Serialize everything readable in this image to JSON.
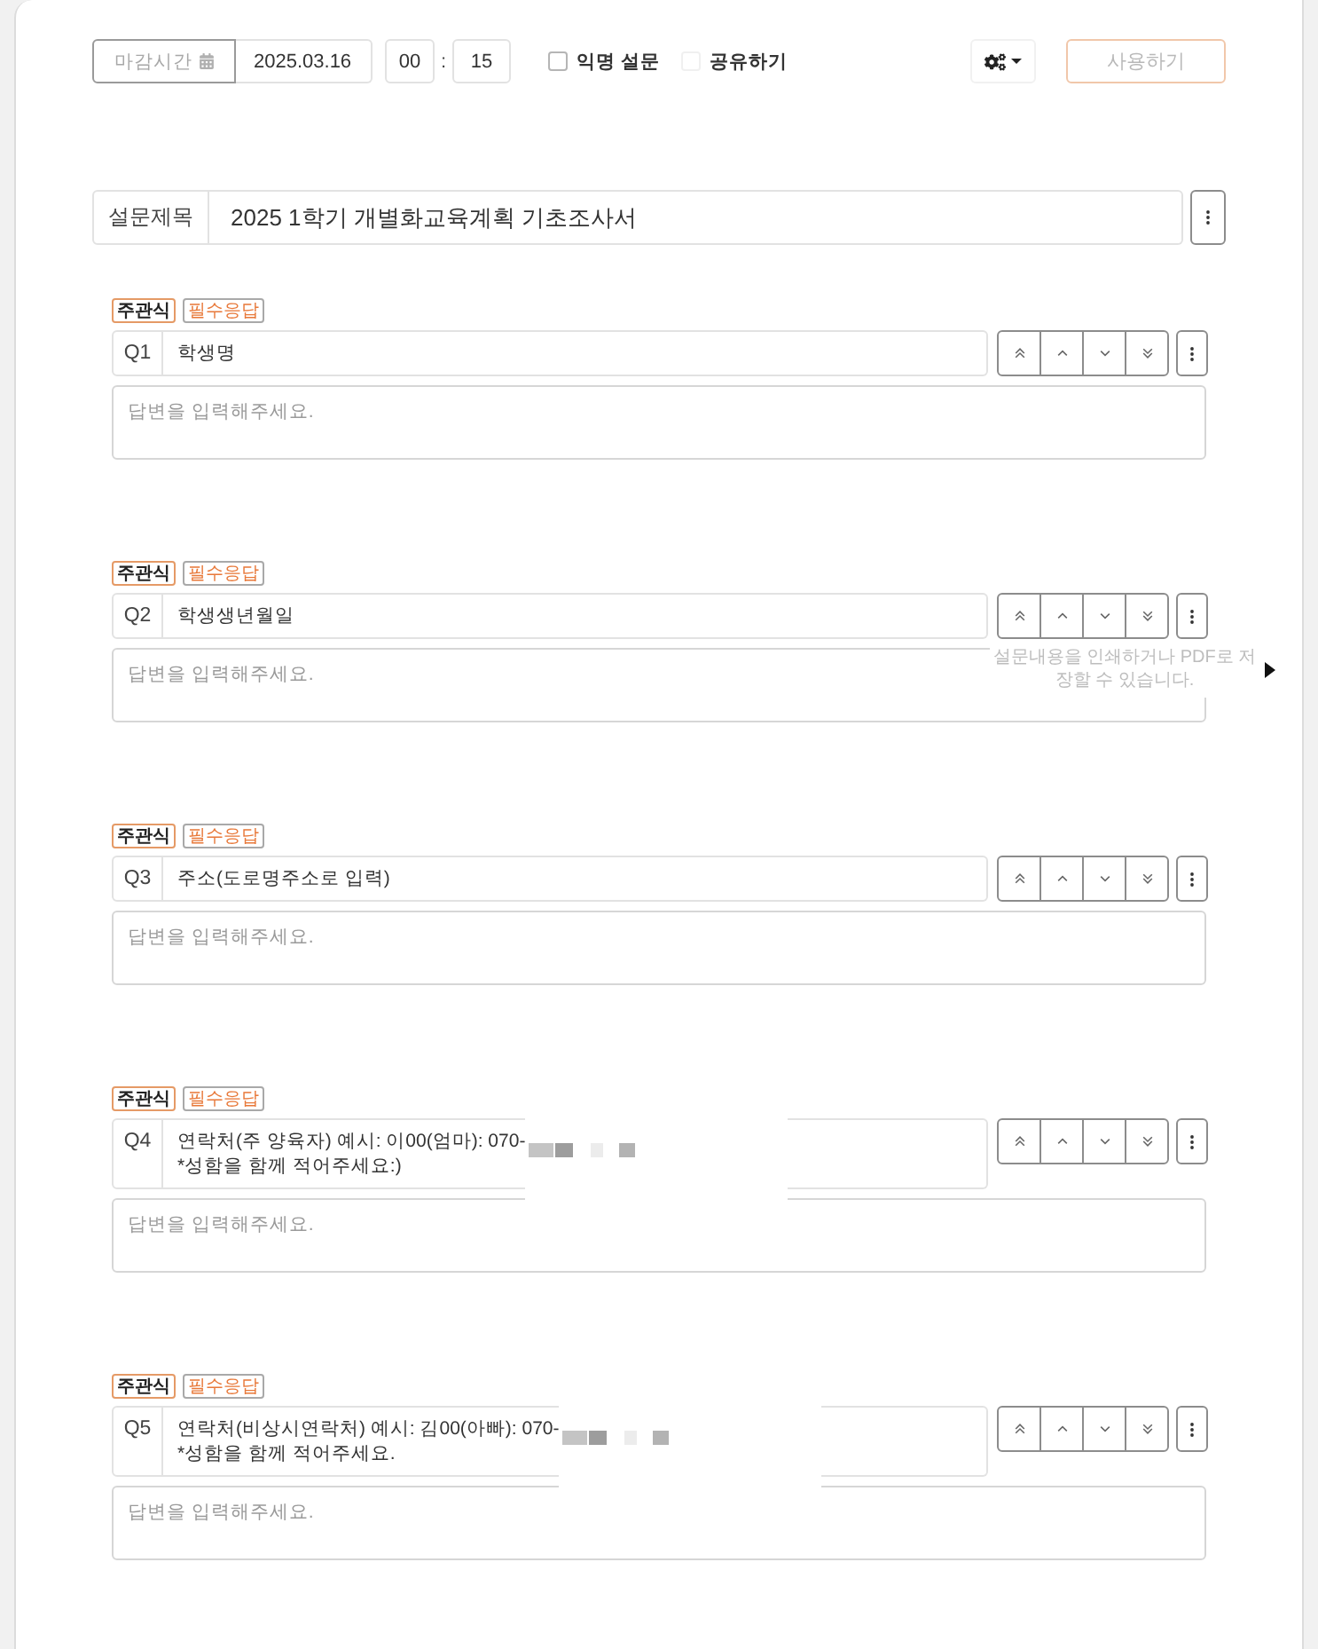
{
  "toolbar": {
    "deadline_label": "마감시간",
    "date": "2025.03.16",
    "hour": "00",
    "separator": ":",
    "minute": "15",
    "anonymous": {
      "label": "익명 설문",
      "checked": false
    },
    "share": {
      "label": "공유하기",
      "checked": false
    },
    "use_button": {
      "label": "사용하기",
      "disabled": true
    }
  },
  "survey_title": {
    "label": "설문제목",
    "value": "2025 1학기 개별화교육계획 기초조사서"
  },
  "questions": [
    {
      "badges": [
        {
          "kind": "type",
          "label": "주관식"
        },
        {
          "kind": "required",
          "label": "필수응답"
        }
      ],
      "number": "Q1",
      "lines": [
        "학생명"
      ],
      "redacted": false,
      "answer": {
        "placeholder": "답변을 입력해주세요."
      }
    },
    {
      "badges": [
        {
          "kind": "type",
          "label": "주관식"
        },
        {
          "kind": "required",
          "label": "필수응답"
        }
      ],
      "number": "Q2",
      "lines": [
        "학생생년월일"
      ],
      "redacted": false,
      "answer": {
        "placeholder": "답변을 입력해주세요."
      }
    },
    {
      "badges": [
        {
          "kind": "type",
          "label": "주관식"
        },
        {
          "kind": "required",
          "label": "필수응답"
        }
      ],
      "number": "Q3",
      "lines": [
        "주소(도로명주소로 입력)"
      ],
      "redacted": false,
      "answer": {
        "placeholder": "답변을 입력해주세요."
      }
    },
    {
      "badges": [
        {
          "kind": "type",
          "label": "주관식"
        },
        {
          "kind": "required",
          "label": "필수응답"
        }
      ],
      "number": "Q4",
      "lines": [
        "연락처(주 양육자) 예시: 이00(엄마): 070-",
        "*성함을 함께 적어주세요:)"
      ],
      "redacted": true,
      "answer": {
        "placeholder": "답변을 입력해주세요."
      }
    },
    {
      "badges": [
        {
          "kind": "type",
          "label": "주관식"
        },
        {
          "kind": "required",
          "label": "필수응답"
        }
      ],
      "number": "Q5",
      "lines": [
        "연락처(비상시연락처) 예시: 김00(아빠): 070-",
        "*성함을 함께 적어주세요."
      ],
      "redacted": true,
      "answer": {
        "placeholder": "답변을 입력해주세요."
      }
    }
  ],
  "tooltip": {
    "text": "설문내용을 인쇄하거나 PDF로 저장할 수 있습니다."
  }
}
